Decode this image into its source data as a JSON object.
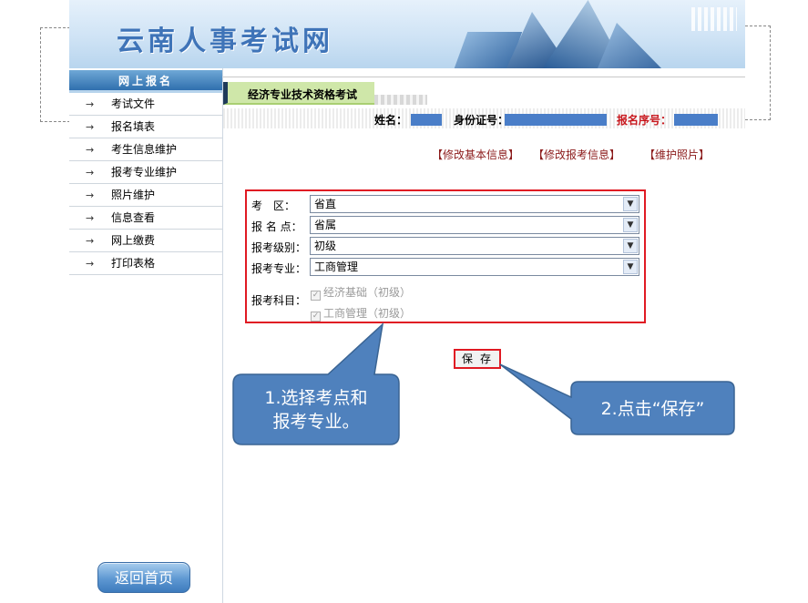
{
  "banner": {
    "title": "云南人事考试网"
  },
  "sidebar": {
    "header": "网上报名",
    "arrow_glyph": "→",
    "items": [
      {
        "label": "考试文件"
      },
      {
        "label": "报名填表"
      },
      {
        "label": "考生信息维护"
      },
      {
        "label": "报考专业维护"
      },
      {
        "label": "照片维护"
      },
      {
        "label": "信息查看"
      },
      {
        "label": "网上缴费"
      },
      {
        "label": "打印表格"
      }
    ],
    "home_button": "返回首页"
  },
  "exam": {
    "tab_label": "经济专业技术资格考试",
    "info": {
      "name_label": "姓名：",
      "id_label": "身份证号：",
      "serial_label": "报名序号："
    }
  },
  "links": {
    "edit_basic": "【修改基本信息】",
    "edit_exam": "【修改报考信息】",
    "edit_photo": "【维护照片】"
  },
  "form": {
    "area": {
      "label": "考　区：",
      "value": "省直"
    },
    "site": {
      "label": "报 名 点：",
      "value": "省属"
    },
    "level": {
      "label": "报考级别：",
      "value": "初级"
    },
    "major": {
      "label": "报考专业：",
      "value": "工商管理"
    },
    "subjects_label": "报考科目：",
    "subjects": [
      {
        "label": "经济基础（初级）",
        "checked": true
      },
      {
        "label": "工商管理（初级）",
        "checked": true
      }
    ],
    "save_button": "保存"
  },
  "callouts": {
    "one": {
      "line1": "1.选择考点和",
      "line2": "报考专业。"
    },
    "two": {
      "text": "2.点击“保存”"
    }
  },
  "colors": {
    "callout_fill": "#4f81bd",
    "highlight": "#e01a23",
    "link": "#8b1a1a"
  }
}
